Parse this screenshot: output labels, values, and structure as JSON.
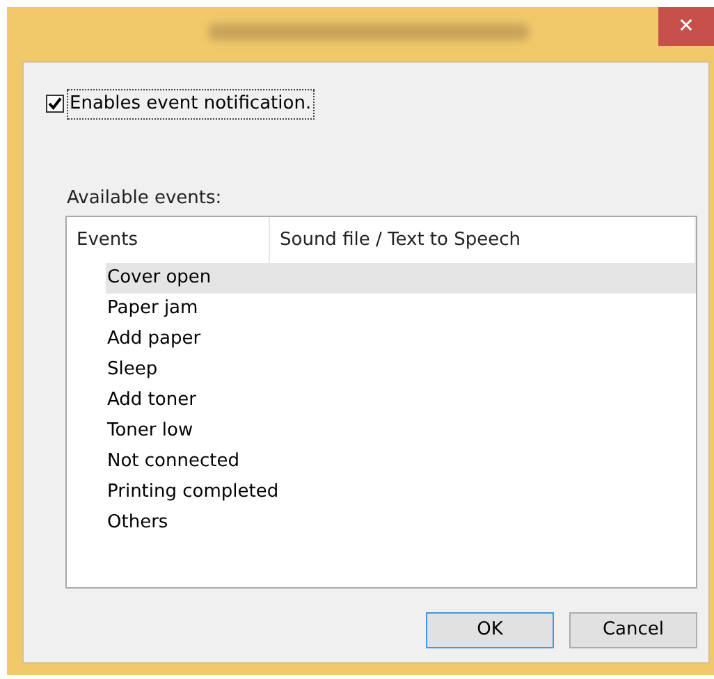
{
  "window": {
    "close": "✕"
  },
  "enable_checkbox": {
    "label": "Enables event notification.",
    "checked": true
  },
  "events_label": "Available events:",
  "table": {
    "columns": [
      "Events",
      "Sound file / Text to Speech"
    ],
    "rows": [
      {
        "event": "Cover open",
        "selected": true
      },
      {
        "event": "Paper jam",
        "selected": false
      },
      {
        "event": "Add paper",
        "selected": false
      },
      {
        "event": "Sleep",
        "selected": false
      },
      {
        "event": "Add toner",
        "selected": false
      },
      {
        "event": "Toner low",
        "selected": false
      },
      {
        "event": "Not connected",
        "selected": false
      },
      {
        "event": "Printing completed",
        "selected": false
      },
      {
        "event": "Others",
        "selected": false
      }
    ]
  },
  "buttons": [
    {
      "label": "OK",
      "kind": "default"
    },
    {
      "label": "Cancel",
      "kind": "normal"
    }
  ]
}
